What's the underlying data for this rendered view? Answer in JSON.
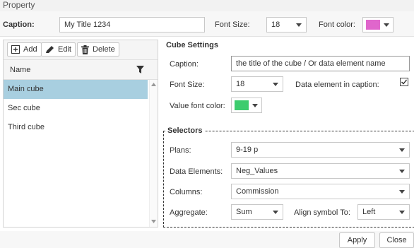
{
  "window": {
    "title": "Property"
  },
  "top": {
    "caption_label": "Caption:",
    "caption_value": "My Title 1234",
    "font_size_label": "Font Size:",
    "font_size_value": "18",
    "font_color_label": "Font color:",
    "font_color": "#e066cc"
  },
  "toolbar": {
    "add_label": "Add",
    "edit_label": "Edit",
    "delete_label": "Delete"
  },
  "list": {
    "header": "Name",
    "items": [
      {
        "label": "Main cube",
        "selected": true
      },
      {
        "label": "Sec cube",
        "selected": false
      },
      {
        "label": "Third cube",
        "selected": false
      }
    ]
  },
  "cube_settings": {
    "title": "Cube Settings",
    "caption_label": "Caption:",
    "caption_value": "the title of the cube / Or data element name",
    "font_size_label": "Font Size:",
    "font_size_value": "18",
    "data_element_label": "Data element in caption:",
    "data_element_checked": true,
    "value_font_color_label": "Value font color:",
    "value_font_color": "#3dcc6e"
  },
  "selectors": {
    "title": "Selectors",
    "plans_label": "Plans:",
    "plans_value": "9-19 p",
    "data_elements_label": "Data Elements:",
    "data_elements_value": "Neg_Values",
    "columns_label": "Columns:",
    "columns_value": "Commission",
    "aggregate_label": "Aggregate:",
    "aggregate_value": "Sum",
    "align_label": "Align symbol To:",
    "align_value": "Left"
  },
  "footer": {
    "apply_label": "Apply",
    "close_label": "Close"
  }
}
